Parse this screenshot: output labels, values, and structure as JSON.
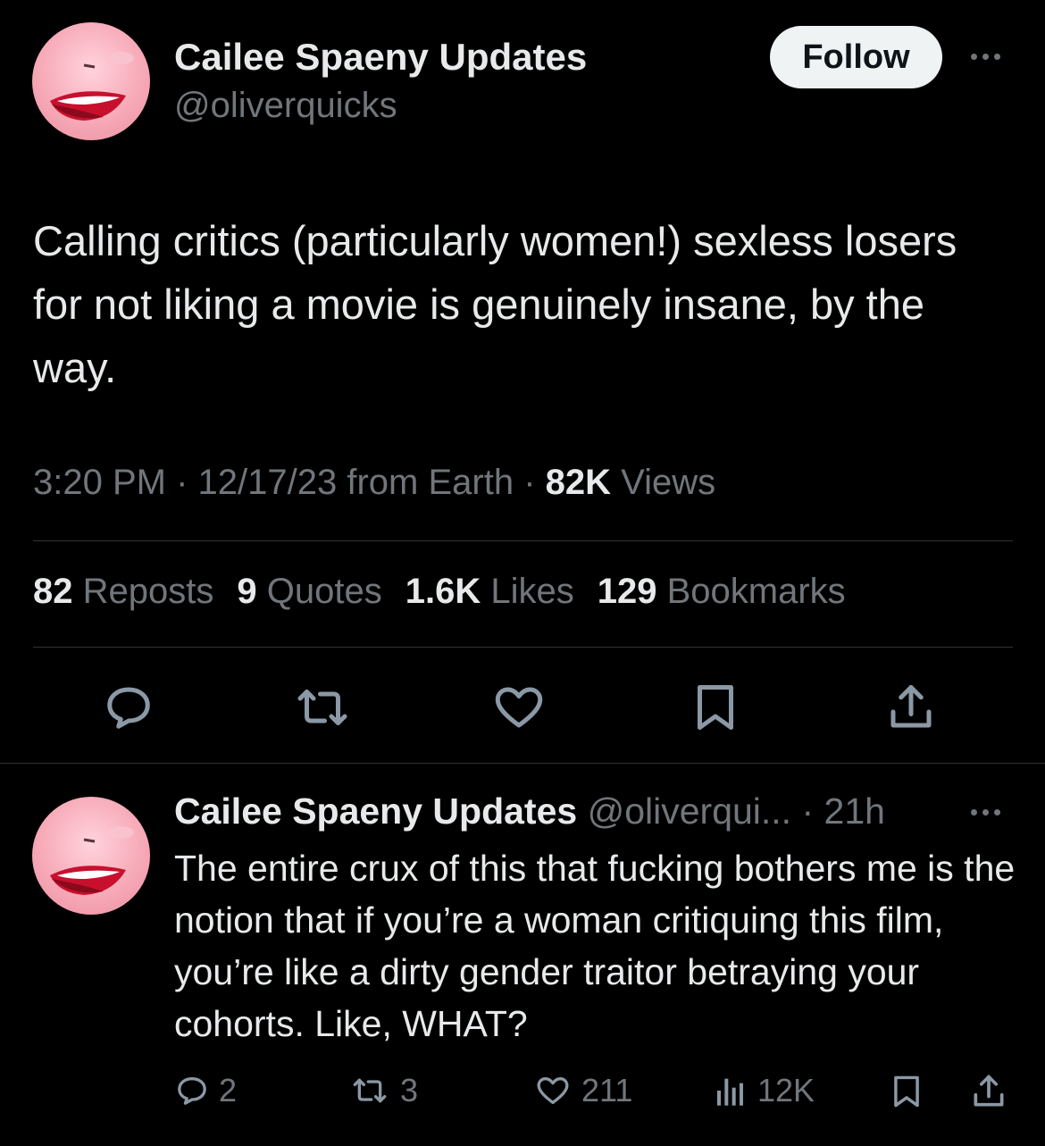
{
  "main_tweet": {
    "author_name": "Cailee Spaeny Updates",
    "handle": "@oliverquicks",
    "follow_label": "Follow",
    "text": "Calling critics (particularly women!) sexless losers for not liking a movie is genuinely insane, by the way.",
    "time": "3:20 PM",
    "date": "12/17/23 from Earth",
    "views_count": "82K",
    "views_label": "Views",
    "stats": {
      "reposts_count": "82",
      "reposts_label": "Reposts",
      "quotes_count": "9",
      "quotes_label": "Quotes",
      "likes_count": "1.6K",
      "likes_label": "Likes",
      "bookmarks_count": "129",
      "bookmarks_label": "Bookmarks"
    },
    "icons": [
      "reply-icon",
      "repost-icon",
      "like-icon",
      "bookmark-icon",
      "share-icon"
    ]
  },
  "reply_tweet": {
    "author_name": "Cailee Spaeny Updates",
    "handle_time": "@oliverqui... · 21h",
    "text": "The entire crux of this that fucking bothers me is the notion that if you’re a woman critiquing this film, you’re like a dirty gender traitor betraying your cohorts. Like, WHAT?",
    "replies": "2",
    "reposts": "3",
    "likes": "211",
    "views": "12K"
  },
  "colors": {
    "background": "#000000",
    "primary_text": "#e7e9ea",
    "secondary_text": "#71767b",
    "divider": "#2f3336",
    "follow_bg": "#eff3f4"
  }
}
